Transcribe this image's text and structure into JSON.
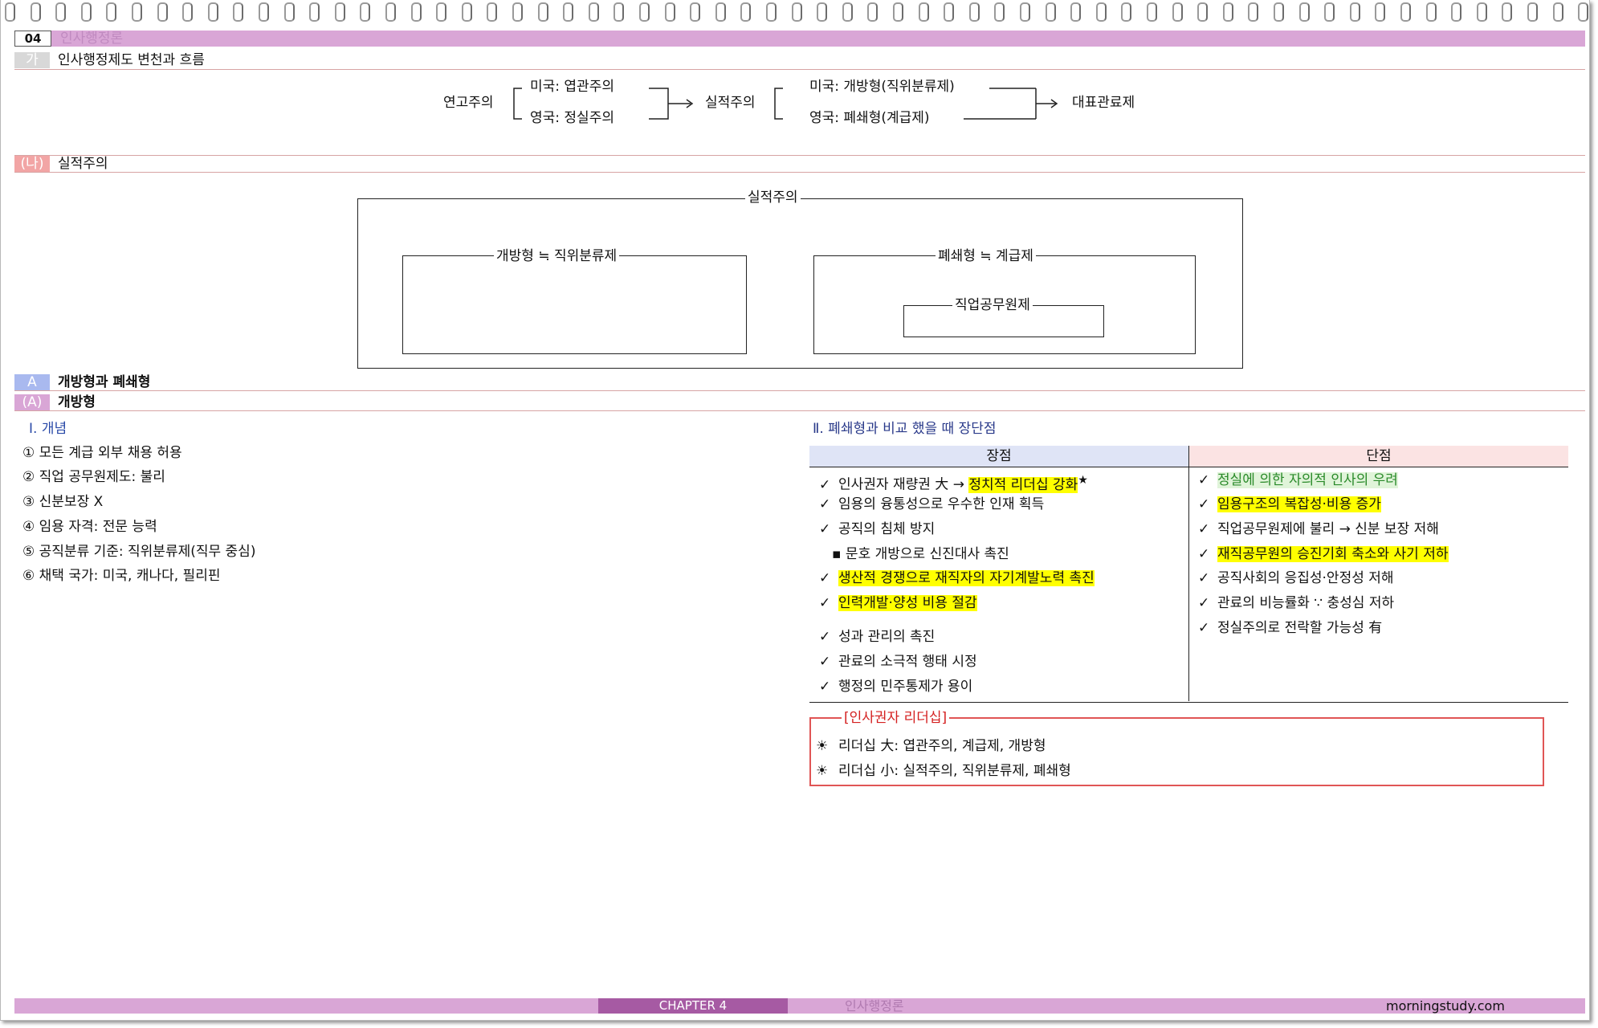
{
  "header": {
    "chapter_num": "04",
    "chapter_title": "인사행정론"
  },
  "sections": {
    "ga": {
      "marker": "가",
      "title": "인사행정제도 변천과 흐름"
    },
    "na": {
      "marker": "(나)",
      "title": "실적주의"
    },
    "A": {
      "marker": "A",
      "title": "개방형과 폐쇄형"
    },
    "Aa": {
      "marker": "(A)",
      "title": "개방형"
    }
  },
  "flow": {
    "seniority": "연고주의",
    "us_spoils": "미국: 엽관주의",
    "uk_patronage": "영국: 정실주의",
    "merit": "실적주의",
    "us_open": "미국: 개방형(직위분류제)",
    "uk_closed": "영국: 폐쇄형(계급제)",
    "representative": "대표관료제"
  },
  "merit_diagram": {
    "outer": "실적주의",
    "open": "개방형 ≒ 직위분류제",
    "closed": "폐쇄형 ≒ 계급제",
    "career": "직업공무원제"
  },
  "concept": {
    "heading": "Ⅰ. 개념",
    "items": [
      "① 모든 계급 외부 채용 허용",
      "② 직업 공무원제도: 불리",
      "③ 신분보장 X",
      "④ 임용 자격: 전문 능력",
      "⑤ 공직분류 기준: 직위분류제(직무 중심)",
      "⑥ 채택 국가: 미국, 캐나다, 필리핀"
    ]
  },
  "comparison": {
    "heading": "Ⅱ. 폐쇄형과 비교 했을 때 장단점",
    "pros_header": "장점",
    "cons_header": "단점",
    "check": "✓",
    "pros": {
      "p1_pre": "인사권자 재량권 大 → ",
      "p1_hl": "정치적 리더십 강화",
      "p1_star": "★",
      "p2": "임용의 융통성으로 우수한 인재 획득",
      "p3": "공직의 침체 방지",
      "p3_sub": "▪ 문호 개방으로 신진대사 촉진",
      "p4_hl": "생산적 경쟁으로 재직자의 자기계발노력 촉진",
      "p5_hl": "인력개발·양성 비용 절감",
      "p6": "성과 관리의 촉진",
      "p7": "관료의 소극적 행태 시정",
      "p8": "행정의 민주통제가 용이"
    },
    "cons": {
      "c1_hl": "정실에 의한 자의적 인사의 우려",
      "c2_hl": "임용구조의 복잡성·비용 증가",
      "c3": "직업공무원제에 불리 → 신분 보장 저해",
      "c4_hl": "재직공무원의 승진기회 축소와 사기 저하",
      "c5": "공직사회의 응집성·안정성 저해",
      "c6": "관료의 비능률화 ∵ 충성심 저하",
      "c7": "정실주의로 전락할 가능성 有"
    }
  },
  "leadership": {
    "title": "[인사권자 리더십]",
    "bullet": "☀",
    "big": "리더십 大: 엽관주의, 계급제, 개방형",
    "small": "리더십 小: 실적주의, 직위분류제, 폐쇄형"
  },
  "footer": {
    "chapter": "CHAPTER 4",
    "subject": "인사행정론",
    "site": "morningstudy.com"
  }
}
